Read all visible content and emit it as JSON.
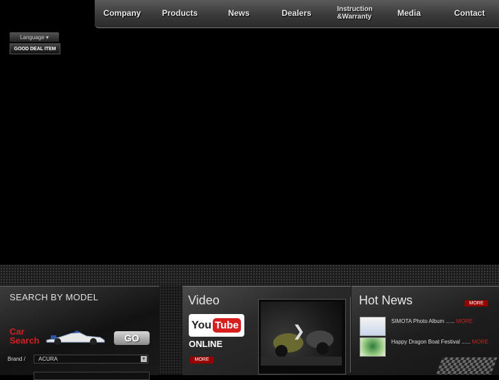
{
  "nav": {
    "items": [
      {
        "label": "Company"
      },
      {
        "label": "Products"
      },
      {
        "label": "News"
      },
      {
        "label": "Dealers"
      },
      {
        "label": "Instruction\n&Warranty"
      },
      {
        "label": "Media"
      },
      {
        "label": "Contact"
      }
    ]
  },
  "topleft": {
    "language": "Language ▾",
    "good_deal": "GOOD DEAL ITEM"
  },
  "search": {
    "title": "SEARCH BY MODEL",
    "car_search": "Car\nSearch",
    "go": "GO",
    "brand_label": "Brand /",
    "brand_value": "ACURA",
    "brand_arrow": "▾"
  },
  "video": {
    "title": "Video",
    "yt_you": "You",
    "yt_tube": "Tube",
    "online": "ONLINE",
    "more": "MORE",
    "play": "❯"
  },
  "news": {
    "title": "Hot News",
    "more": "MORE",
    "items": [
      {
        "text": "SIMOTA Photo Album ......",
        "more": "MORE"
      },
      {
        "text": "Happy Dragon Boat Festival ......",
        "more": "MORE"
      }
    ]
  },
  "colors": {
    "accent_red": "#d21f1f",
    "more_red": "#990000"
  }
}
